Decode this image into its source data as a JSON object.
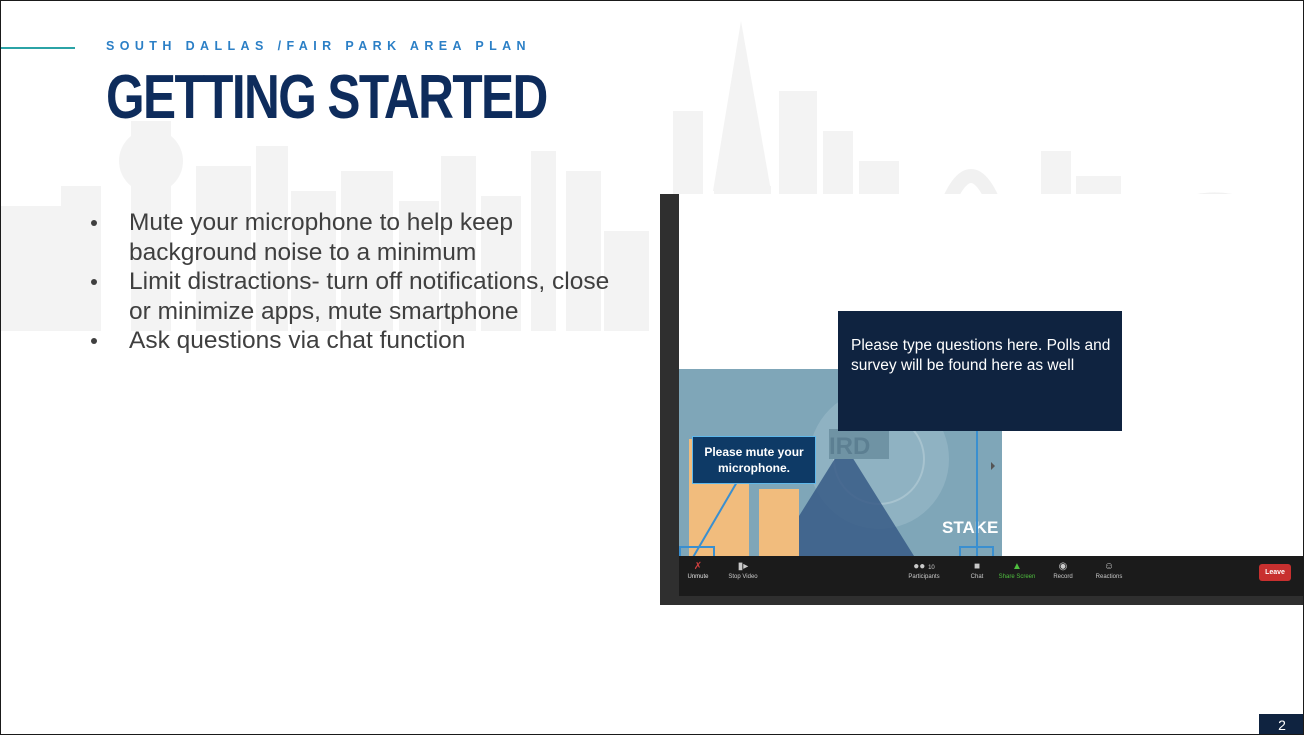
{
  "header": {
    "subtitle": "SOUTH DALLAS /FAIR PARK AREA PLAN",
    "title": "GETTING STARTED"
  },
  "bullets": [
    "Mute your microphone to help keep background noise to a minimum",
    "Limit distractions- turn off notifications, close or minimize apps, mute smartphone",
    "Ask questions via chat function"
  ],
  "screenshot": {
    "chat_callout": "Please type questions here. Polls and survey will be found here as well",
    "mute_callout": "Please mute your microphone.",
    "stage_text": "STAKE",
    "toolbar": {
      "unmute": "Unmute",
      "stop_video": "Stop Video",
      "participants": "Participants",
      "participants_count": "10",
      "chat": "Chat",
      "share_screen": "Share Screen",
      "record": "Record",
      "reactions": "Reactions",
      "leave": "Leave"
    }
  },
  "footer": {
    "page_number": "2"
  },
  "colors": {
    "title_navy": "#0e2c5c",
    "subtitle_blue": "#2b7fc6",
    "accent_teal": "#2ba3a6",
    "callout_navy": "#0f2340",
    "highlight_blue": "#3a8fd0",
    "share_green": "#4fbf3f",
    "leave_red": "#c8302f"
  }
}
